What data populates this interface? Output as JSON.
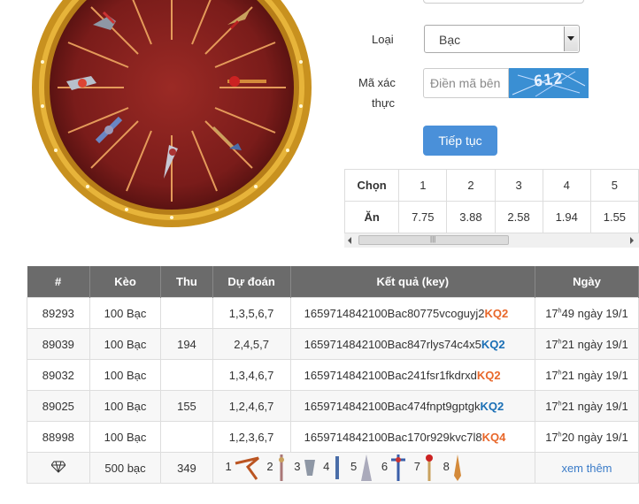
{
  "form": {
    "type_label": "Loại",
    "type_value": "Bạc",
    "captcha_label_1": "Mã xác",
    "captcha_label_2": "thực",
    "captcha_placeholder": "Điền mã bên",
    "captcha_code": "612",
    "continue_label": "Tiếp tục"
  },
  "odds": {
    "choose_label": "Chọn",
    "win_label": "Ăn",
    "choices": [
      "1",
      "2",
      "3",
      "4",
      "5"
    ],
    "payouts": [
      "7.75",
      "3.88",
      "2.58",
      "1.94",
      "1.55"
    ]
  },
  "history": {
    "headers": [
      "#",
      "Kèo",
      "Thu",
      "Dự đoán",
      "Kết quả (key)",
      "Ngày"
    ],
    "rows": [
      {
        "id": "89293",
        "bet": "100 Bạc",
        "gain": "",
        "guess": "1,3,5,6,7",
        "key": "1659714842100Bac80775vcoguyj2",
        "kq": "KQ2",
        "hour": "17",
        "rest": "49 ngày 19/1"
      },
      {
        "id": "89039",
        "bet": "100 Bạc",
        "gain": "194",
        "guess": "2,4,5,7",
        "key": "1659714842100Bac847rlys74c4x5",
        "kq": "KQ2",
        "hour": "17",
        "rest": "21 ngày 19/1"
      },
      {
        "id": "89032",
        "bet": "100 Bạc",
        "gain": "",
        "guess": "1,3,4,6,7",
        "key": "1659714842100Bac241fsr1fkdrxd",
        "kq": "KQ2",
        "hour": "17",
        "rest": "21 ngày 19/1"
      },
      {
        "id": "89025",
        "bet": "100 Bạc",
        "gain": "155",
        "guess": "1,2,4,6,7",
        "key": "1659714842100Bac474fnpt9gptgk",
        "kq": "KQ2",
        "hour": "17",
        "rest": "21 ngày 19/1"
      },
      {
        "id": "88998",
        "bet": "100 Bạc",
        "gain": "",
        "guess": "1,2,3,6,7",
        "key": "1659714842100Bac170r929kvc7l8",
        "kq": "KQ4",
        "hour": "17",
        "rest": "20 ngày 19/1"
      }
    ],
    "summary": {
      "bet": "500 bạc",
      "gain": "349",
      "more": "xem thêm",
      "weapon_numbers": [
        "1",
        "2",
        "3",
        "4",
        "5",
        "6",
        "7",
        "8"
      ]
    }
  },
  "colors": {
    "win": "#1a6fb5",
    "lose": "#e8672a",
    "button": "#4a90d9",
    "header": "#6b6b6b"
  }
}
